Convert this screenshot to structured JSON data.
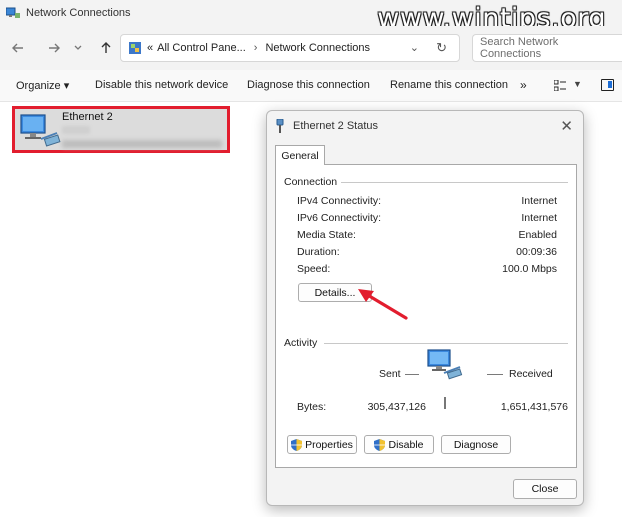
{
  "window": {
    "title": "Network Connections",
    "watermark": "www.wintips.org"
  },
  "nav": {
    "back_icon": "arrow-left-icon",
    "forward_icon": "arrow-right-icon",
    "recent_icon": "chevron-down-icon",
    "up_icon": "arrow-up-icon",
    "breadcrumb": [
      "All Control Pane...",
      "Network Connections"
    ],
    "breadcrumb_prefix": "«",
    "search_placeholder": "Search Network Connections"
  },
  "toolbar": {
    "organize": "Organize ▾",
    "disable": "Disable this network device",
    "diagnose": "Diagnose this connection",
    "rename": "Rename this connection",
    "more": "»"
  },
  "connection_item": {
    "name": "Ethernet 2"
  },
  "dialog": {
    "title": "Ethernet 2 Status",
    "close_glyph": "✕",
    "tab": "General",
    "connection_group": "Connection",
    "rows": [
      {
        "label": "IPv4 Connectivity:",
        "value": "Internet"
      },
      {
        "label": "IPv6 Connectivity:",
        "value": "Internet"
      },
      {
        "label": "Media State:",
        "value": "Enabled"
      },
      {
        "label": "Duration:",
        "value": "00:09:36"
      },
      {
        "label": "Speed:",
        "value": "100.0 Mbps"
      }
    ],
    "details_button": "Details...",
    "activity_group": "Activity",
    "sent_label": "Sent",
    "received_label": "Received",
    "bytes_label": "Bytes:",
    "bytes_sent": "305,437,126",
    "bytes_received": "1,651,431,576",
    "properties_button": "Properties",
    "disable_button": "Disable",
    "diagnose_button": "Diagnose",
    "close_button": "Close"
  },
  "colors": {
    "highlight_border": "#e21d2e",
    "arrow": "#e21d2e",
    "accent": "#1f6fd6"
  }
}
